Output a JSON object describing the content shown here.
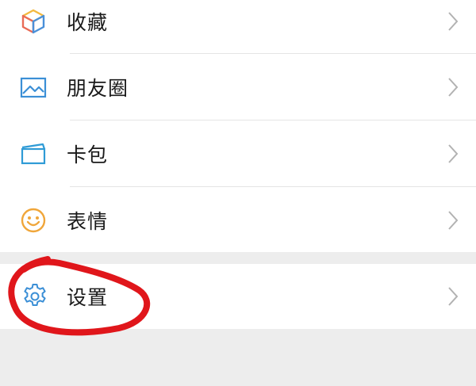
{
  "menu": {
    "items": [
      {
        "label": "收藏",
        "icon": "favorites-cube-icon"
      },
      {
        "label": "朋友圈",
        "icon": "moments-picture-icon"
      },
      {
        "label": "卡包",
        "icon": "card-wallet-icon"
      },
      {
        "label": "表情",
        "icon": "smiley-face-icon"
      }
    ],
    "settings": {
      "label": "设置",
      "icon": "gear-icon"
    }
  },
  "colors": {
    "page_background": "#ededed",
    "row_background": "#ffffff",
    "favorites_yellow": "#f3b93f",
    "favorites_red": "#e96b56",
    "favorites_blue": "#4a90d9",
    "moments_blue": "#3b8fd6",
    "card_blue": "#2f9bd6",
    "smiley_orange": "#f0a63a",
    "settings_blue": "#3b8fd6",
    "annotation_red": "#e0161b"
  },
  "annotation": {
    "shape": "hand-drawn circle",
    "target": "settings row"
  }
}
